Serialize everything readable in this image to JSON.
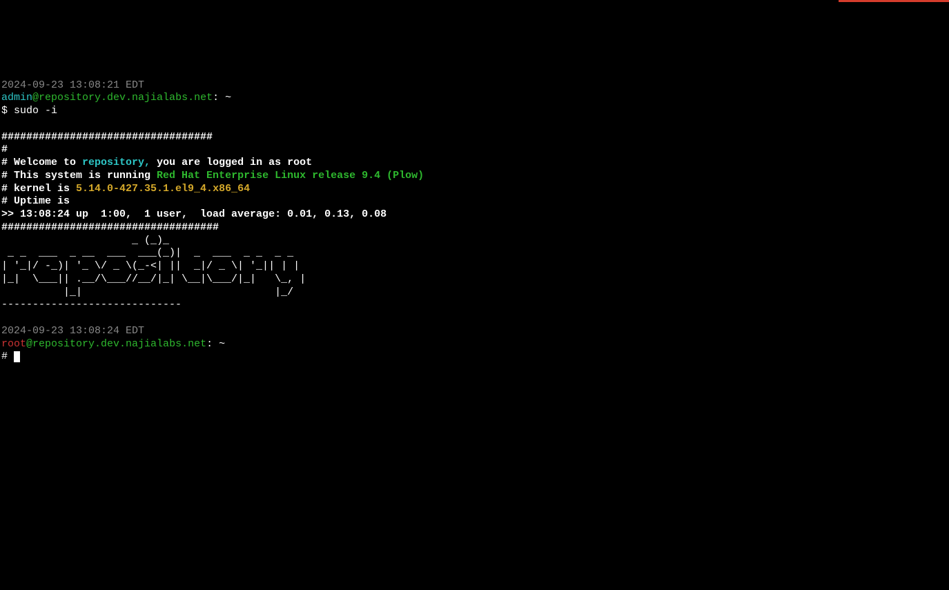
{
  "timestamp1": "2024-09-23 13:08:21 EDT",
  "prompt1": {
    "user": "admin",
    "at": "@",
    "host": "repository.dev.najialabs.net",
    "suffix": ": ~"
  },
  "command1": {
    "ps": "$ ",
    "cmd": "sudo -i"
  },
  "motd": {
    "bar1": "##################################",
    "hash": "#",
    "welcome_pre": "# Welcome to ",
    "welcome_repo": "repository,",
    "welcome_mid": " you are logged in as ",
    "welcome_user": "root",
    "os_pre": "# This system is running ",
    "os_name": "Red Hat Enterprise Linux release 9.4 (Plow)",
    "kernel_pre": "# kernel is ",
    "kernel_name": "5.14.0-427.35.1.el9_4.x86_64",
    "uptime_pre": "# Uptime is",
    "uptime_line": ">> 13:08:24 up  1:00,  1 user,  load average: 0.01, 0.13, 0.08",
    "bar2": "###################################"
  },
  "ascii": {
    "l1": "                     _ (_)_",
    "l2": " _ _  ___  _ __  ___  ___(_)|  _  ___  _ _  _ _",
    "l3": "| '_|/ -_)| '_ \\/ _ \\(_-<| ||  _|/ _ \\| '_|| | |",
    "l4": "|_|  \\___|| .__/\\___//__/|_| \\__|\\___/|_|   \\_, |",
    "l5": "          |_|                               |_/",
    "l6": "-----------------------------"
  },
  "timestamp2": "2024-09-23 13:08:24 EDT",
  "prompt2": {
    "user": "root",
    "at": "@",
    "host": "repository.dev.najialabs.net",
    "suffix": ": ~"
  },
  "prompt2_ps": "# "
}
